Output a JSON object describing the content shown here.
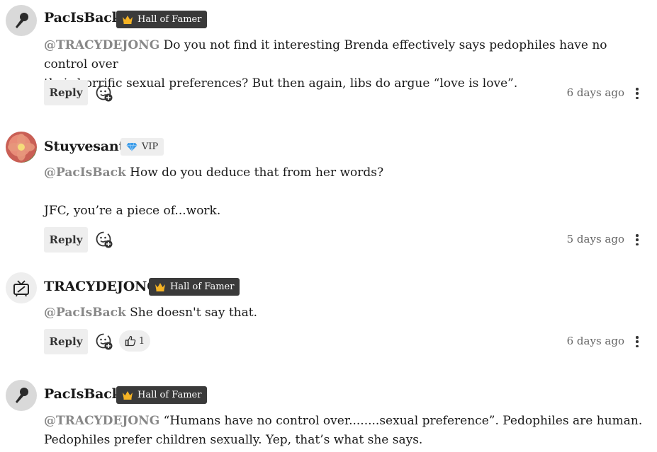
{
  "comments": [
    {
      "user": "PacIsBack",
      "badge": "Hall of Famer",
      "mention": "@TRACYDEJONG",
      "text_lines": [
        " Do you not find it interesting Brenda effectively says pedophiles have no control over",
        "their horrific sexual preferences? But then again, libs do argue “love is love”."
      ],
      "reply": "Reply",
      "time": "6 days ago",
      "avatar_icon": "microphone-icon"
    },
    {
      "user": "Stuyvesant",
      "badge": "VIP",
      "mention": "@PacIsBack",
      "text_line1": " How do you deduce that from her words?",
      "text_line2": "JFC, you’re a piece of...work.",
      "reply": "Reply",
      "time": "5 days ago",
      "avatar_icon": "flower-avatar"
    },
    {
      "user": "TRACYDEJONG",
      "badge": "Hall of Famer",
      "mention": "@PacIsBack",
      "text": " She doesn't say that.",
      "reply": "Reply",
      "reaction_count": "1",
      "time": "6 days ago",
      "avatar_icon": "tv-icon"
    },
    {
      "user": "PacIsBack",
      "badge": "Hall of Famer",
      "mention": "@TRACYDEJONG",
      "text_lines": [
        " “Humans have no control over........sexual preference”. Pedophiles are human.",
        "Pedophiles prefer children sexually. Yep, that’s what she says."
      ],
      "avatar_icon": "microphone-icon"
    }
  ],
  "colors": {
    "badge_dark": "#3a3a3a",
    "badge_light": "#eeeeee",
    "mention": "#888888",
    "crown": "#f5b324"
  }
}
